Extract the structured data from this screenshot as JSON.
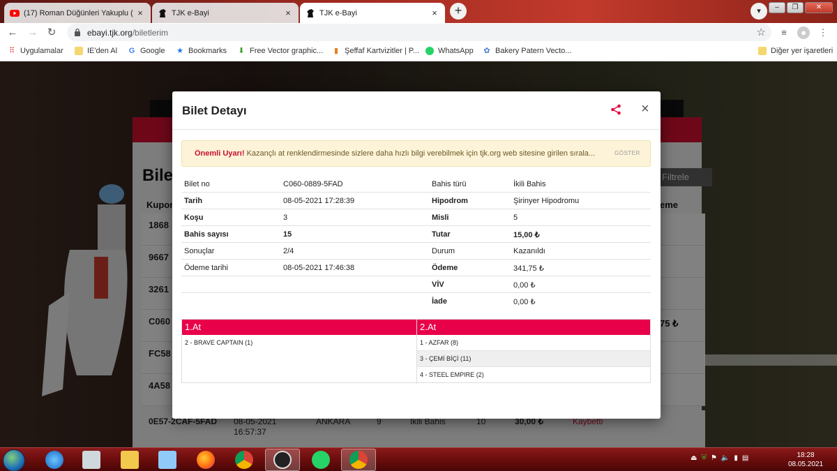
{
  "browser": {
    "tabs": [
      {
        "title": "(17) Roman Düğünleri Yakuplu (",
        "icon": "youtube-icon"
      },
      {
        "title": "TJK e-Bayi",
        "icon": "horse-icon"
      },
      {
        "title": "TJK e-Bayi",
        "icon": "horse-icon"
      }
    ],
    "active_tab": 2,
    "new_tab": "+",
    "url_host": "ebayi.tjk.org",
    "url_path": "/biletlerim",
    "bookmarks": [
      {
        "label": "Uygulamalar",
        "icon": "apps-grid-icon"
      },
      {
        "label": "IE'den Al",
        "icon": "folder-icon"
      },
      {
        "label": "Google",
        "icon": "google-icon"
      },
      {
        "label": "Bookmarks",
        "icon": "star-icon"
      },
      {
        "label": "Free Vector graphic...",
        "icon": "download-icon"
      },
      {
        "label": "Şeffaf Kartvizitler | P...",
        "icon": "page-icon"
      },
      {
        "label": "WhatsApp",
        "icon": "whatsapp-icon"
      },
      {
        "label": "Bakery Patern Vecto...",
        "icon": "cog-icon"
      }
    ],
    "other_bookmarks": "Diğer yer işaretleri"
  },
  "page": {
    "title": "Bilet",
    "col_kupon": "Kupon",
    "col_eme": "eme",
    "filter": "Filtrele",
    "rows": [
      "1868",
      "9667",
      "3261",
      "C060",
      "FC58",
      "4A58"
    ],
    "right_value": "75 ₺",
    "last_row": {
      "kupon": "0E57-2CAF-5FAD",
      "date": "08-05-2021",
      "time": "16:57:37",
      "hipodrom": "ANKARA",
      "kosu": "9",
      "bahis": "İkili Bahis",
      "sayi": "10",
      "tutar": "30,00 ₺",
      "durum": "Kaybetti"
    }
  },
  "modal": {
    "title": "Bilet Detayı",
    "close": "×",
    "alert_strong": "Önemli Uyarı!",
    "alert_text": " Kazançlı at renklendirmesinde sizlere daha hızlı bilgi verebilmek için tjk.org web sitesine girilen sırala...",
    "alert_button": "GÖSTER",
    "details": [
      {
        "l1": "Bilet no",
        "v1": "C060-0889-5FAD",
        "l2": "Bahis türü",
        "v2": "İkili Bahis"
      },
      {
        "l1": "Tarih",
        "v1": "08-05-2021 17:28:39",
        "l2": "Hipodrom",
        "v2": "Şirinyer Hipodromu"
      },
      {
        "l1": "Koşu",
        "v1": "3",
        "l2": "Misli",
        "v2": "5"
      },
      {
        "l1": "Bahis sayısı",
        "v1": "15",
        "l2": "Tutar",
        "v2": "15,00 ₺"
      },
      {
        "l1": "Sonuçlar",
        "v1": "2/4",
        "l2": "Durum",
        "v2": "Kazanıldı"
      },
      {
        "l1": "Ödeme tarihi",
        "v1": "08-05-2021 17:46:38",
        "l2": "Ödeme",
        "v2": "341,75 ₺"
      },
      {
        "l1": "",
        "v1": "",
        "l2": "VİV",
        "v2": "0,00 ₺"
      },
      {
        "l1": "",
        "v1": "",
        "l2": "İade",
        "v2": "0,00 ₺"
      }
    ],
    "horses": {
      "col1_header": "1.At",
      "col2_header": "2.At",
      "col1": [
        "2 - BRAVE CAPTAIN (1)"
      ],
      "col2": [
        "1 - AZFAR (8)",
        "3 - ÇEMİ BİÇİ (11)",
        "4 - STEEL EMPIRE (2)"
      ]
    }
  },
  "taskbar": {
    "apps": [
      "internet-explorer-icon",
      "calculator-icon",
      "file-explorer-icon",
      "network-computer-icon",
      "firefox-icon",
      "chrome-icon",
      "pen-app-icon",
      "whatsapp-icon",
      "chrome-icon"
    ],
    "time": "18:28",
    "date": "08.05.2021"
  },
  "colors": {
    "brand_red": "#c8102e",
    "header_pink": "#e8004a",
    "alert_bg": "#fcf3d8"
  }
}
